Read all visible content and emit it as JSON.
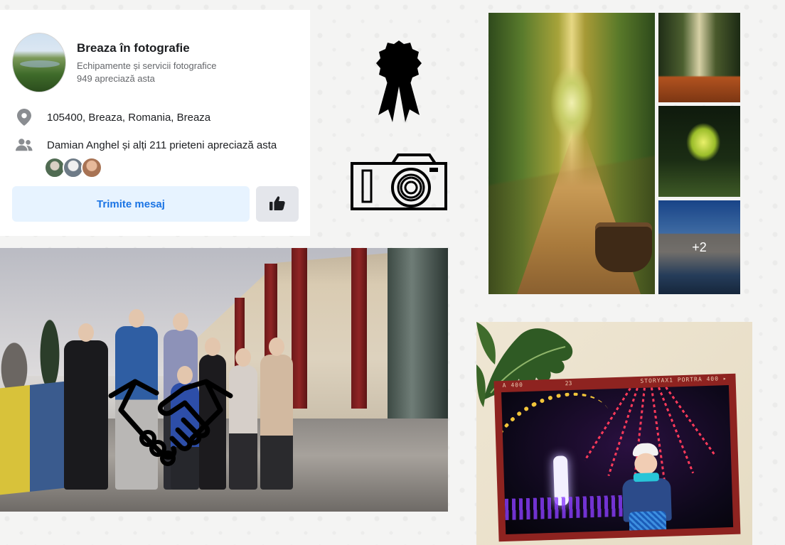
{
  "profile": {
    "name": "Breaza în fotografie",
    "category": "Echipamente și servicii fotografice",
    "likes": "949 apreciază asta",
    "address": "105400, Breaza, Romania, Breaza",
    "friends_like": "Damian Anghel și alți 211 prieteni apreciază asta",
    "message_button": "Trimite mesaj"
  },
  "icons": {
    "location": "location-pin-icon",
    "friends": "people-icon",
    "like": "thumbs-up-icon",
    "award": "award-ribbon-icon",
    "camera": "camera-icon",
    "handshake": "handshake-icon"
  },
  "gallery": {
    "more_count": "+2"
  },
  "xmas_frame": {
    "left_text": "A 400",
    "mid_text": "23",
    "right_text": "STORYAX1 PORTRA 400 ▸"
  },
  "colors": {
    "button_bg": "#e7f3ff",
    "button_text": "#1b74e4",
    "like_bg": "#e4e6eb",
    "frame_red": "#8e2320"
  }
}
